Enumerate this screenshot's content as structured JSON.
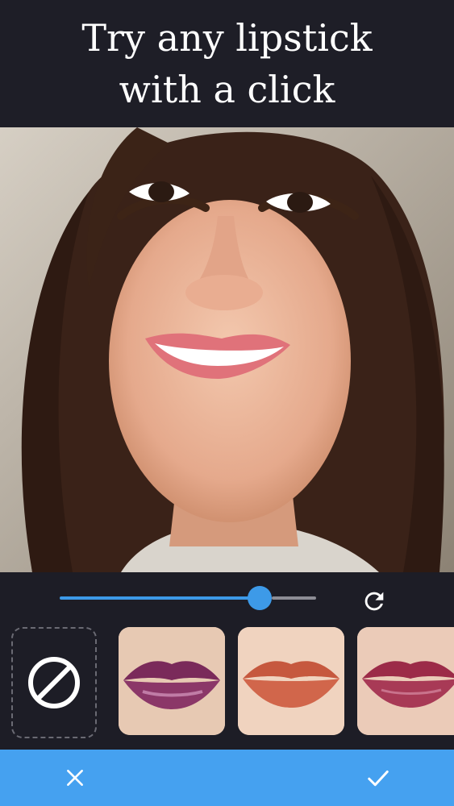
{
  "header": {
    "line1": "Try any lipstick",
    "line2": "with a click"
  },
  "photo": {
    "subject": "portrait-photo"
  },
  "intensity_slider": {
    "value_fraction": 0.78,
    "fill_color": "#3d9ae8",
    "rest_color": "#8d8d95"
  },
  "reset_button": {
    "icon": "refresh-icon"
  },
  "swatches": [
    {
      "id": "none",
      "icon": "no-symbol-icon"
    },
    {
      "id": "plum-gloss",
      "color": "#7a2a5a"
    },
    {
      "id": "terracotta",
      "color": "#c6583e"
    },
    {
      "id": "berry",
      "color": "#9c2b48"
    }
  ],
  "bottom_bar": {
    "color": "#45a1f0",
    "cancel_icon": "close-icon",
    "confirm_icon": "check-icon"
  }
}
